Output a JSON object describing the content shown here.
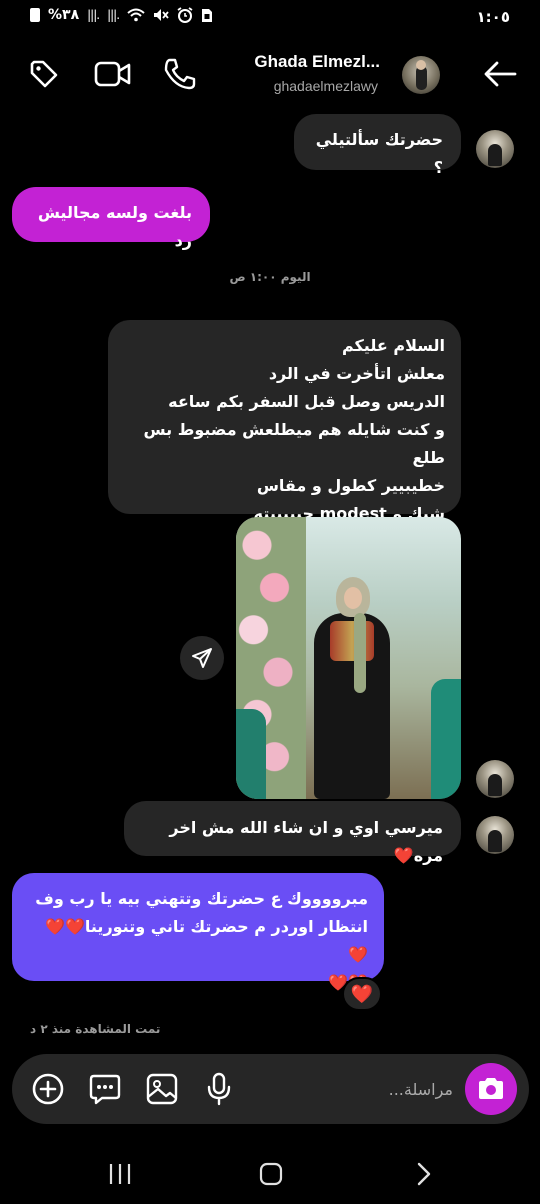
{
  "status_bar": {
    "time": "١:٠٥",
    "battery": "%٣٨",
    "signal": "|||.",
    "icons": [
      "battery-icon",
      "signal-icon",
      "wifi-icon",
      "mute-icon",
      "alarm-icon",
      "sim-icon"
    ]
  },
  "header": {
    "name": "Ghada Elmezl...",
    "username": "ghadaelmezlawy",
    "icons": [
      "back-arrow-icon",
      "phone-icon",
      "video-call-icon",
      "tag-icon"
    ]
  },
  "messages": [
    {
      "id": "m1",
      "direction": "in",
      "text": "حضرتك سألتيلي ؟"
    },
    {
      "id": "m2",
      "direction": "out",
      "text": "بلغت ولسه مجاليش رد"
    },
    {
      "id": "m4",
      "direction": "in",
      "lines": [
        "السلام عليكم",
        "معلش اتأخرت في الرد",
        "الدريس وصل قبل السفر بكم ساعه",
        "و كنت شايله هم ميطلعش مضبوط بس طلع",
        "خطيبيير كطول و مقاس",
        "شيك و modest حبيبييته"
      ]
    },
    {
      "id": "m5",
      "direction": "in",
      "type": "photo"
    },
    {
      "id": "m6",
      "direction": "in",
      "text": "ميرسي اوي و ان شاء الله مش اخر مره❤️"
    },
    {
      "id": "m7",
      "direction": "out",
      "lines": [
        "مبرووووك ع حضرتك وتتهني بيه يا رب وف",
        "انتظار اوردر م حضرتك تاني وتنورينا❤️❤️❤️",
        "❤️❤️"
      ],
      "reaction": "❤️"
    }
  ],
  "timestamp": "اليوم ١:٠٠ ص",
  "seen_text": "تمت المشاهدة منذ ٢ د",
  "composer": {
    "placeholder": "مراسلة...",
    "icons": [
      "camera-icon",
      "microphone-icon",
      "gallery-icon",
      "sticker-icon",
      "add-icon"
    ]
  },
  "colors": {
    "background": "#000000",
    "incoming_bubble": "#262626",
    "outgoing_pink": "#c322d4",
    "outgoing_purple": "#6a4ef5"
  }
}
